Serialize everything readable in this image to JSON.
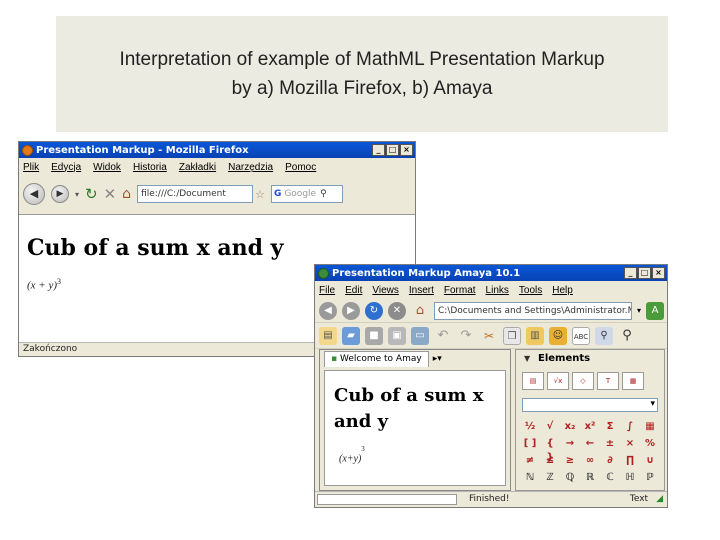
{
  "slide": {
    "title_line1": "Interpretation of example of MathML Presentation Markup",
    "title_line2": "by a) Mozilla Firefox, b) Amaya"
  },
  "firefox": {
    "window_title": "Presentation Markup - Mozilla Firefox",
    "menu": [
      "Plik",
      "Edycja",
      "Widok",
      "Historia",
      "Zakładki",
      "Narzędzia",
      "Pomoc"
    ],
    "url": "file:///C:/Document",
    "search_placeholder": "Google",
    "heading": "Cub of a sum x and y",
    "formula": "(x + y)",
    "formula_exponent": "3",
    "status": "Zakończono"
  },
  "amaya": {
    "window_title": "Presentation Markup   Amaya 10.1",
    "menu": [
      "File",
      "Edit",
      "Views",
      "Insert",
      "Format",
      "Links",
      "Tools",
      "Help"
    ],
    "url": "C:\\Documents and Settings\\Administrator.MOTHE",
    "tab_label": "Welcome to Amay",
    "panel_title": "Elements",
    "heading_line1": "Cub of a sum x",
    "heading_line2": "and y",
    "formula": "(x+y)",
    "formula_exponent": "3",
    "status": "Finished!",
    "mode": "Text"
  }
}
